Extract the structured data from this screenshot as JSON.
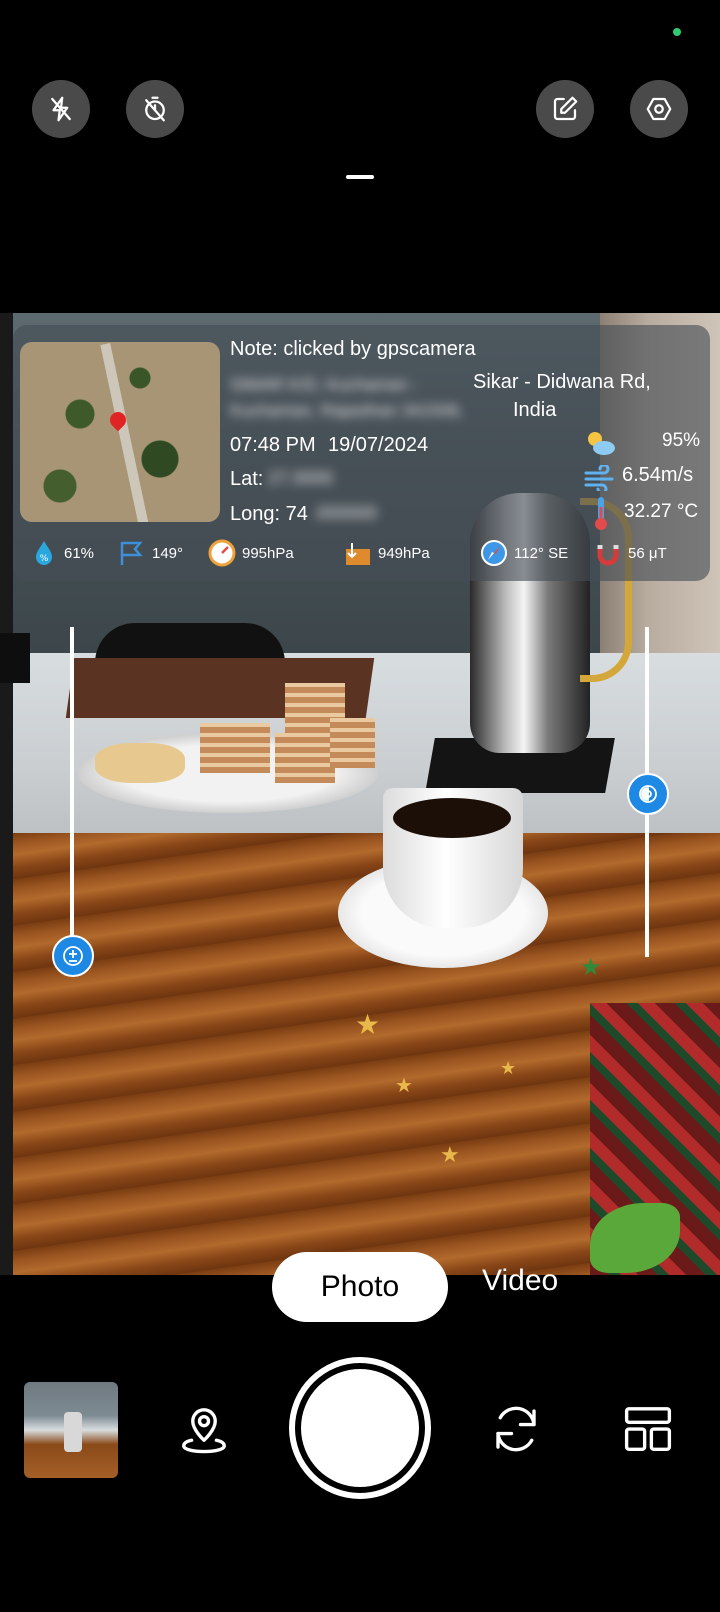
{
  "top_bar": {
    "buttons": [
      {
        "name": "flash-off-icon"
      },
      {
        "name": "timer-off-icon"
      },
      {
        "name": "edit-icon"
      },
      {
        "name": "settings-icon"
      }
    ],
    "status_dot_color": "#2ecc71"
  },
  "overlay": {
    "note": "Note: clicked by gpscamera",
    "address_blurred": "SIMAR K/D, Kuchaman - Kuchaman, Rajasthan 341508,",
    "place": "Sikar - Didwana Rd,",
    "country": "India",
    "time": "07:48 PM",
    "date": "19/07/2024",
    "lat_label": "Lat:",
    "lat_value_blurred": "27.0000",
    "long_label": "Long: 74",
    "long_value_blurred": ".000000",
    "cloud": "95%",
    "wind": "6.54m/s",
    "temperature": "32.27 °C",
    "stats": {
      "humidity": "61%",
      "wind_dir": "149°",
      "pressure": "995hPa",
      "altitude_pressure": "949hPa",
      "compass": "112° SE",
      "magnetic": "56 μT"
    }
  },
  "camera": {
    "exposure_slider_level": 0.6,
    "zoom_slider_level": 0.5
  },
  "modes": {
    "photo": "Photo",
    "video": "Video",
    "active": "Photo"
  },
  "bottom_bar": {
    "icons": [
      "gallery-thumbnail",
      "location-pin-icon",
      "shutter-button",
      "switch-camera-icon",
      "template-layout-icon"
    ]
  },
  "colors": {
    "accent": "#1e88e5",
    "background": "#000000"
  }
}
